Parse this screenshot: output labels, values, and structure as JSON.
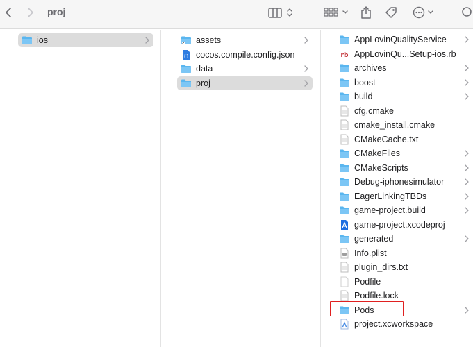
{
  "window": {
    "title": "proj"
  },
  "toolbar": {
    "back_icon": "chevron-left-icon",
    "forward_icon": "chevron-right-icon",
    "view_icon": "column-view-icon",
    "group_icon": "grid-group-icon",
    "share_icon": "share-icon",
    "tag_icon": "tag-icon",
    "more_icon": "ellipsis-circle-icon",
    "search_icon": "search-icon"
  },
  "colors": {
    "folder": "#5ab6ef",
    "selection": "#dcdcdc",
    "highlight_box": "#e02020"
  },
  "column1": [
    {
      "label": "ios",
      "icon": "folder-icon",
      "selected": true,
      "chevron": true
    }
  ],
  "column2": [
    {
      "label": "assets",
      "icon": "folder-alias-icon",
      "selected": false,
      "chevron": true
    },
    {
      "label": "cocos.compile.config.json",
      "icon": "json-file-icon",
      "selected": false,
      "chevron": false
    },
    {
      "label": "data",
      "icon": "folder-icon",
      "selected": false,
      "chevron": true
    },
    {
      "label": "proj",
      "icon": "folder-icon",
      "selected": true,
      "chevron": true
    }
  ],
  "column3": [
    {
      "label": "AppLovinQualityService",
      "icon": "folder-icon",
      "chevron": true
    },
    {
      "label": "AppLovinQu...Setup-ios.rb",
      "icon": "ruby-file-icon",
      "chevron": false
    },
    {
      "label": "archives",
      "icon": "folder-icon",
      "chevron": true
    },
    {
      "label": "boost",
      "icon": "folder-icon",
      "chevron": true
    },
    {
      "label": "build",
      "icon": "folder-icon",
      "chevron": true
    },
    {
      "label": "cfg.cmake",
      "icon": "document-icon",
      "chevron": false
    },
    {
      "label": "cmake_install.cmake",
      "icon": "document-icon",
      "chevron": false
    },
    {
      "label": "CMakeCache.txt",
      "icon": "document-icon",
      "chevron": false
    },
    {
      "label": "CMakeFiles",
      "icon": "folder-icon",
      "chevron": true
    },
    {
      "label": "CMakeScripts",
      "icon": "folder-icon",
      "chevron": true
    },
    {
      "label": "Debug-iphonesimulator",
      "icon": "folder-icon",
      "chevron": true
    },
    {
      "label": "EagerLinkingTBDs",
      "icon": "folder-icon",
      "chevron": true
    },
    {
      "label": "game-project.build",
      "icon": "folder-icon",
      "chevron": true
    },
    {
      "label": "game-project.xcodeproj",
      "icon": "xcodeproj-icon",
      "chevron": false
    },
    {
      "label": "generated",
      "icon": "folder-icon",
      "chevron": true
    },
    {
      "label": "Info.plist",
      "icon": "plist-file-icon",
      "chevron": false
    },
    {
      "label": "plugin_dirs.txt",
      "icon": "document-icon",
      "chevron": false
    },
    {
      "label": "Podfile",
      "icon": "blank-document-icon",
      "chevron": false
    },
    {
      "label": "Podfile.lock",
      "icon": "document-icon",
      "chevron": false
    },
    {
      "label": "Pods",
      "icon": "folder-icon",
      "chevron": true,
      "highlighted": true
    },
    {
      "label": "project.xcworkspace",
      "icon": "xcworkspace-icon",
      "chevron": false
    }
  ]
}
